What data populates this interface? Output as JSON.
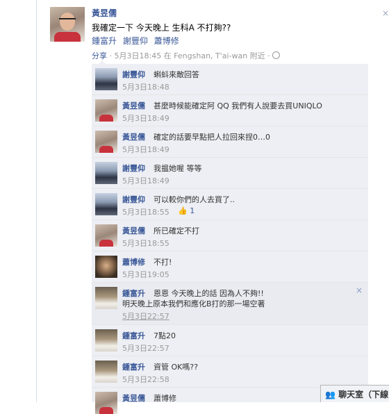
{
  "post": {
    "author": "黃昱儒",
    "text": "我確定一下 今天晚上 生科A 不打夠??",
    "tagged": [
      "鍾富升",
      "謝豐仰",
      "蕭博修"
    ],
    "share_link": "分享",
    "meta_rest": " · 5月3日18:45 在 Fengshan, T'ai-wan 附近 ·",
    "close_icon": "×"
  },
  "comments": [
    {
      "author": "謝豐仰",
      "text": "蝌蚪來敵回答",
      "time": "5月3日18:48",
      "avatar": "b"
    },
    {
      "author": "黃昱儒",
      "text": "甚麼時候能確定阿 QQ 我們有人說要去買UNIQLO",
      "time": "5月3日18:49",
      "avatar": "a"
    },
    {
      "author": "黃昱儒",
      "text": "確定的話要早點把人拉回來捏0…0",
      "time": "5月3日18:49",
      "avatar": "a"
    },
    {
      "author": "謝豐仰",
      "text": "我揾她喔 等等",
      "time": "5月3日18:49",
      "avatar": "b"
    },
    {
      "author": "謝豐仰",
      "text": "可以較你們的人去買了..",
      "time": "5月3日18:55",
      "avatar": "b",
      "likes": "1"
    },
    {
      "author": "黃昱儒",
      "text": "所已確定不打",
      "time": "5月3日18:55",
      "avatar": "a"
    },
    {
      "author": "蕭博修",
      "text": "不打!",
      "time": "5月3日19:05",
      "avatar": "c"
    },
    {
      "author": "鍾富升",
      "text": "恩恩 今天晚上的話 因為人不夠!!",
      "text2": "明天晚上原本我們和應化B打的那一場空著",
      "time": "5月3日22:57",
      "avatar": "d",
      "close_icon": "×"
    },
    {
      "author": "鍾富升",
      "text": "7點20",
      "time": "5月3日22:57",
      "avatar": "d"
    },
    {
      "author": "鍾富升",
      "text": "資管 OK嗎??",
      "time": "5月3日22:58",
      "avatar": "d"
    },
    {
      "author": "黃昱儒",
      "text": "蕭博修",
      "time": "",
      "avatar": "a"
    }
  ],
  "chat": {
    "label": "聊天室（下線"
  }
}
